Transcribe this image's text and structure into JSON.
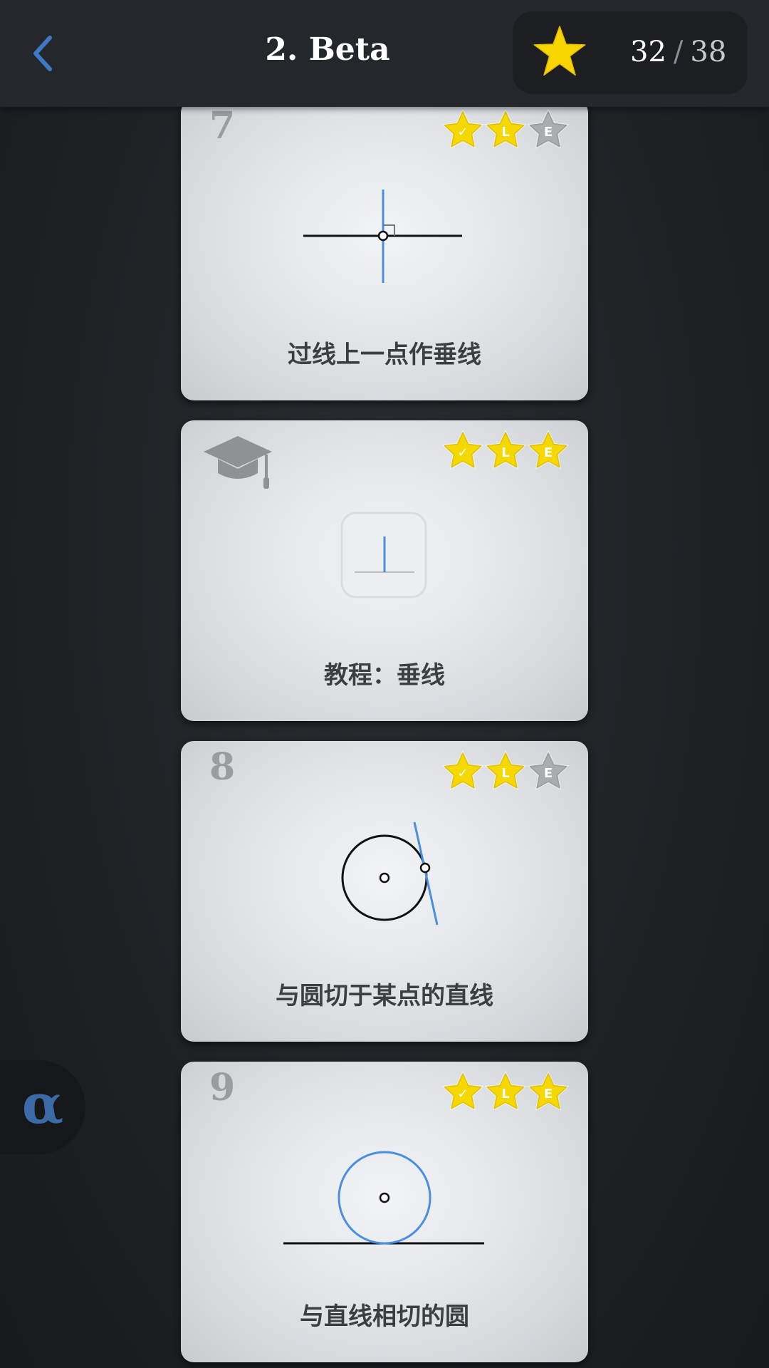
{
  "header": {
    "title": "2. Beta",
    "score_current": "32",
    "score_separator": "/",
    "score_total": "38"
  },
  "levels": [
    {
      "number": "7",
      "title": "过线上一点作垂线",
      "stars": [
        "✓",
        "L",
        "E"
      ],
      "earned": [
        true,
        true,
        false
      ]
    },
    {
      "number": "",
      "title": "教程：垂线",
      "stars": [
        "✓",
        "L",
        "E"
      ],
      "earned": [
        true,
        true,
        true
      ],
      "type": "tutorial"
    },
    {
      "number": "8",
      "title": "与圆切于某点的直线",
      "stars": [
        "✓",
        "L",
        "E"
      ],
      "earned": [
        true,
        true,
        false
      ]
    },
    {
      "number": "9",
      "title": "与直线相切的圆",
      "stars": [
        "✓",
        "L",
        "E"
      ],
      "earned": [
        true,
        true,
        true
      ]
    }
  ],
  "side_button": {
    "label": "α"
  },
  "colors": {
    "accent_blue": "#4a8ee0",
    "star_gold": "#f5d800",
    "star_grey": "#a9adb0",
    "alpha_blue": "#3b6aa6"
  },
  "icons": [
    "back-icon",
    "star-icon",
    "graduation-cap-icon"
  ]
}
